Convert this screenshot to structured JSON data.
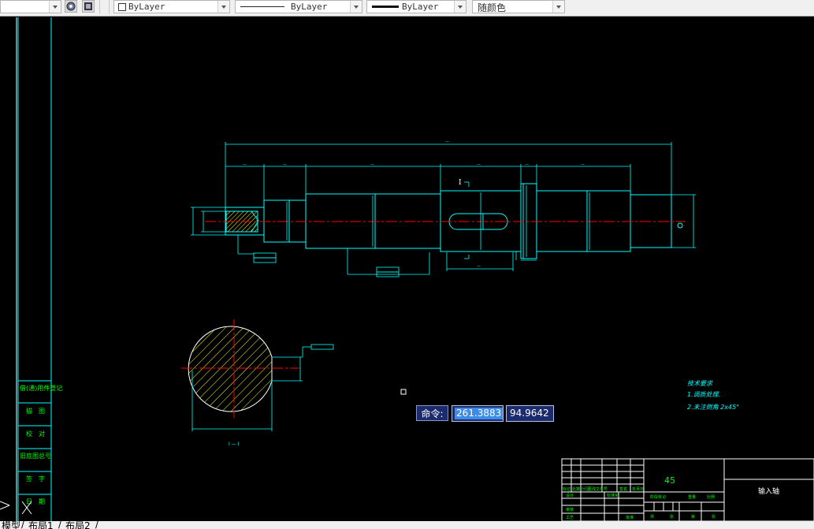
{
  "toolbar": {
    "layer_color": "ByLayer",
    "linetype": "ByLayer",
    "lineweight": "ByLayer",
    "plot_style": "随颜色"
  },
  "command": {
    "label": "命令:",
    "x_value": "261.3883",
    "y_value": "94.9642"
  },
  "tabs": {
    "model": "模型",
    "layout1": "布局1",
    "layout2": "布局2"
  },
  "drawing": {
    "left_stamp_fields": [
      "借(通)用件登记",
      "描　图",
      "校　对",
      "旧底图总号",
      "签　字",
      "日　期"
    ],
    "section_mark": "I",
    "section_label": "I — I",
    "tech_requirements": {
      "title": "技术要求",
      "line1": "1.调质处理.",
      "line2": "2.未注倒角 2x45°"
    },
    "title_block": {
      "material": "45",
      "part_name": "输入轴",
      "row_labels": [
        "标记",
        "处数",
        "分区",
        "更改文件号",
        "签名",
        "年月日"
      ],
      "row2_labels": [
        "设计",
        "标准化",
        "阶段标记",
        "重量",
        "比例"
      ],
      "row3_labels": [
        "审核",
        "工艺",
        "批准",
        "共",
        "张",
        "第",
        "张"
      ]
    }
  },
  "colors": {
    "canvas_bg": "#000000",
    "frame": "#00ffff",
    "part_lines": "#00ffff",
    "center_lines": "#ff0000",
    "text_green": "#00ff00",
    "hatch": "#ffff00",
    "command_bg": "#1c2a6e"
  }
}
